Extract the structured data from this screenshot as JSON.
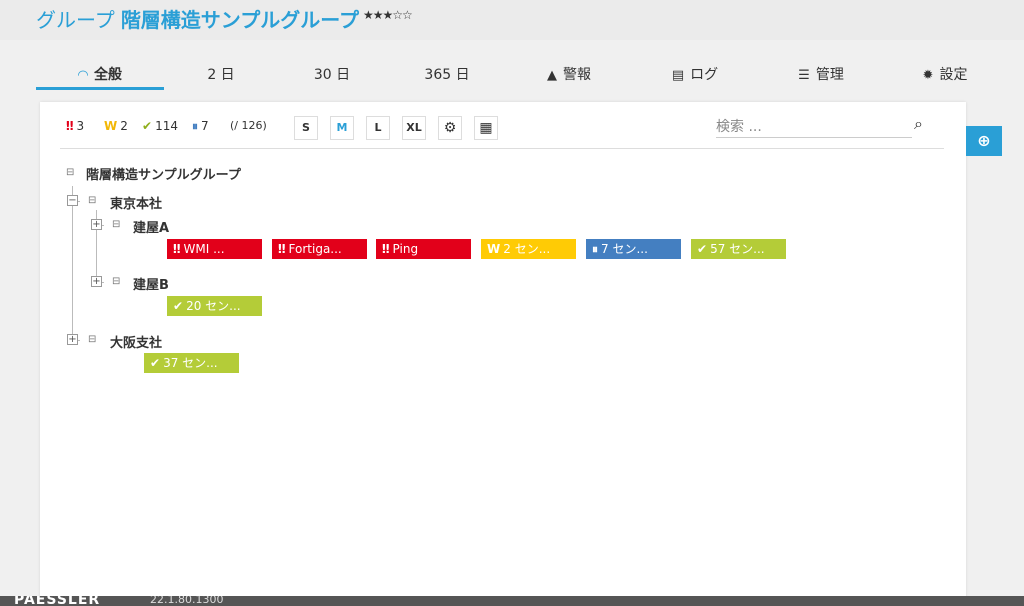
{
  "header": {
    "prefix": "グループ",
    "name": "階層構造サンプルグループ",
    "stars": "★★★☆☆"
  },
  "tabs": [
    {
      "label": "全般",
      "icon": "◠",
      "icon_name": "gauge-icon"
    },
    {
      "label": "2 日"
    },
    {
      "label": "30 日"
    },
    {
      "label": "365 日"
    },
    {
      "label": "警報",
      "icon": "▲",
      "icon_name": "alert-icon"
    },
    {
      "label": "ログ",
      "icon": "▤",
      "icon_name": "log-icon"
    },
    {
      "label": "管理",
      "icon": "☰",
      "icon_name": "sliders-icon"
    },
    {
      "label": "設定",
      "icon": "✹",
      "icon_name": "gear-icon"
    }
  ],
  "toolbar": {
    "stats": [
      {
        "sym": "‼",
        "value": "3",
        "color": "#e2001a"
      },
      {
        "sym": "W",
        "value": "2",
        "color": "#f2b705"
      },
      {
        "sym": "✔",
        "value": "114",
        "color": "#8fae1b"
      },
      {
        "sym": "⏸",
        "value": "7",
        "color": "#447fc1"
      }
    ],
    "total": "(/ 126)",
    "sizes": [
      "S",
      "M",
      "L",
      "XL"
    ],
    "search_placeholder": "検索 ..."
  },
  "tree": {
    "root": "階層構造サンプルグループ",
    "tokyo": "東京本社",
    "buildingA": "建屋A",
    "buildingB": "建屋B",
    "osaka": "大阪支社",
    "buildingA_sensors": [
      {
        "sym": "‼",
        "label": "WMI ..."
      },
      {
        "sym": "‼",
        "label": "Fortiga..."
      },
      {
        "sym": "‼",
        "label": "Ping"
      },
      {
        "sym": "W",
        "label": "2 セン..."
      },
      {
        "sym": "⏸",
        "label": "7 セン..."
      },
      {
        "sym": "✔",
        "label": "57 セン..."
      }
    ],
    "buildingB_sensors": [
      {
        "sym": "✔",
        "label": "20 セン..."
      }
    ],
    "osaka_sensors": [
      {
        "sym": "✔",
        "label": "37 セン..."
      }
    ]
  },
  "footer": {
    "logo": "PAESSLER",
    "info": "22.1.80.1300"
  },
  "colors": {
    "accent": "#2a9fd6",
    "down": "#e2001a",
    "warning": "#ffcb05",
    "paused": "#447fc1",
    "up": "#b4cc38"
  }
}
